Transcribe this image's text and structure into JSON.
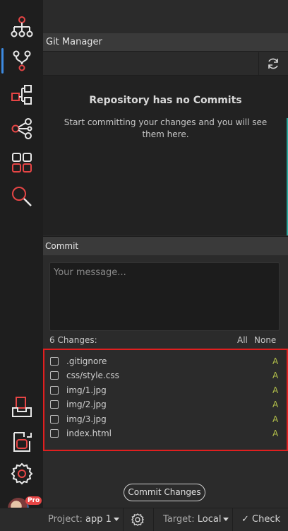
{
  "activity_bar": {
    "items": [
      {
        "icon": "org-chart-icon",
        "active": false
      },
      {
        "icon": "git-branch-icon",
        "active": true
      },
      {
        "icon": "deploy-flow-icon",
        "active": false
      },
      {
        "icon": "share-icon",
        "active": false
      },
      {
        "icon": "apps-grid-icon",
        "active": false
      },
      {
        "icon": "search-icon",
        "active": false
      }
    ],
    "bottom_items": [
      "inbox-tray-icon",
      "export-icon",
      "settings-gear-icon"
    ],
    "badge": "Pro"
  },
  "panel": {
    "title": "Git Manager",
    "empty_title": "Repository has no Commits",
    "empty_subtitle": "Start committing your changes and you will see them here."
  },
  "commit": {
    "header": "Commit",
    "message_placeholder": "Your message...",
    "changes_count": "6 Changes:",
    "select_all": "All",
    "select_none": "None",
    "files": [
      {
        "name": ".gitignore",
        "status": "A"
      },
      {
        "name": "css/style.css",
        "status": "A"
      },
      {
        "name": "img/1.jpg",
        "status": "A"
      },
      {
        "name": "img/2.jpg",
        "status": "A"
      },
      {
        "name": "img/3.jpg",
        "status": "A"
      },
      {
        "name": "index.html",
        "status": "A"
      }
    ],
    "button": "Commit Changes"
  },
  "statusbar": {
    "project_label": "Project:",
    "project_value": "app 1",
    "target_label": "Target:",
    "target_value": "Local",
    "check": "Check"
  },
  "colors": {
    "accent_red": "#e64545",
    "added_status": "#b2bf4a",
    "active_indicator": "#3d8ae0",
    "highlight_border": "#e01f1f"
  }
}
